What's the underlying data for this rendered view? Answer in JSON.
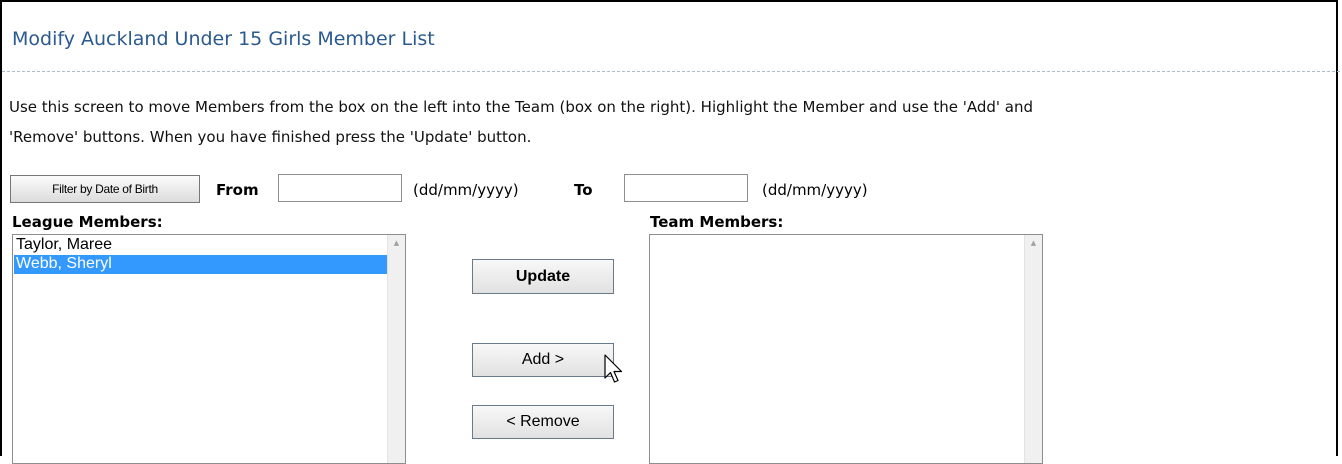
{
  "page": {
    "title": "Modify Auckland Under 15 Girls Member List",
    "instructions_line1": "Use this screen to move Members from the box on the left into the Team (box on the right). Highlight the Member and use the 'Add' and",
    "instructions_line2": "'Remove' buttons. When you have finished press the 'Update' button."
  },
  "filter": {
    "button_label": "Filter by Date of Birth",
    "from_label": "From",
    "from_value": "",
    "from_hint": "(dd/mm/yyyy)",
    "to_label": "To",
    "to_value": "",
    "to_hint": "(dd/mm/yyyy)"
  },
  "league_members": {
    "label": "League Members:",
    "items": [
      {
        "name": "Taylor, Maree",
        "selected": false
      },
      {
        "name": "Webb, Sheryl",
        "selected": true
      }
    ]
  },
  "team_members": {
    "label": "Team Members:",
    "items": []
  },
  "buttons": {
    "update": "Update",
    "add": "Add >",
    "remove": "< Remove"
  },
  "colors": {
    "title": "#2b5a8f",
    "selection": "#3399ff"
  },
  "icons": {
    "scroll_up": "scroll-up-arrow-icon",
    "cursor": "mouse-pointer-icon"
  }
}
